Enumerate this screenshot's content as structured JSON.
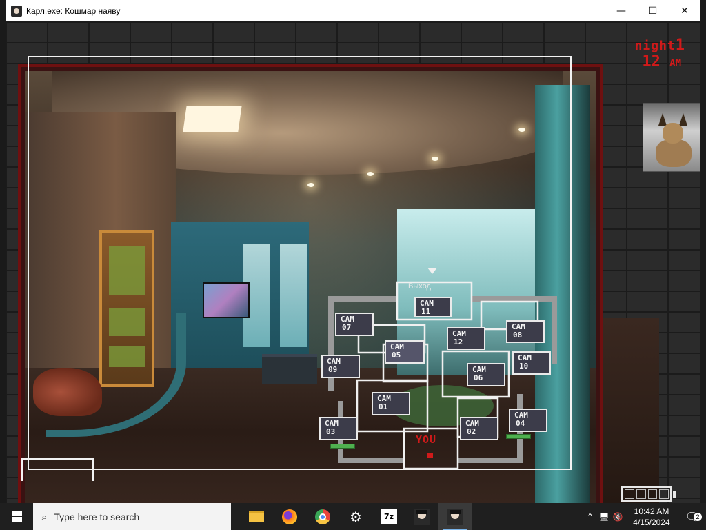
{
  "window": {
    "title": "Карл.exe: Кошмар наяву",
    "min_symbol": "—",
    "max_symbol": "☐",
    "close_symbol": "✕"
  },
  "hud": {
    "night_word": "night",
    "night_number": "1",
    "hour": "12",
    "ampm": "AM"
  },
  "map": {
    "exit_label": "Выход",
    "you_label": "YOU",
    "cams": [
      {
        "label": "CAM",
        "num": "11"
      },
      {
        "label": "CAM",
        "num": "07"
      },
      {
        "label": "CAM",
        "num": "08"
      },
      {
        "label": "CAM",
        "num": "12"
      },
      {
        "label": "CAM",
        "num": "05"
      },
      {
        "label": "CAM",
        "num": "09"
      },
      {
        "label": "CAM",
        "num": "10"
      },
      {
        "label": "CAM",
        "num": "06"
      },
      {
        "label": "CAM",
        "num": "01"
      },
      {
        "label": "CAM",
        "num": "03"
      },
      {
        "label": "CAM",
        "num": "02"
      },
      {
        "label": "CAM",
        "num": "04"
      }
    ]
  },
  "colors": {
    "hud_red": "#d01a1a",
    "monitor_border": "#6e1010",
    "battery_green": "#4fb04f"
  },
  "taskbar": {
    "search_placeholder": "Type here to search",
    "icons": [
      "file-explorer-icon",
      "firefox-icon",
      "chrome-icon",
      "settings-gear-icon",
      "7zip-icon",
      "game-app-icon",
      "game-window-icon"
    ],
    "time": "10:42 AM",
    "date": "4/15/2024",
    "notification_count": "2",
    "seven_zip_label": "7z"
  }
}
